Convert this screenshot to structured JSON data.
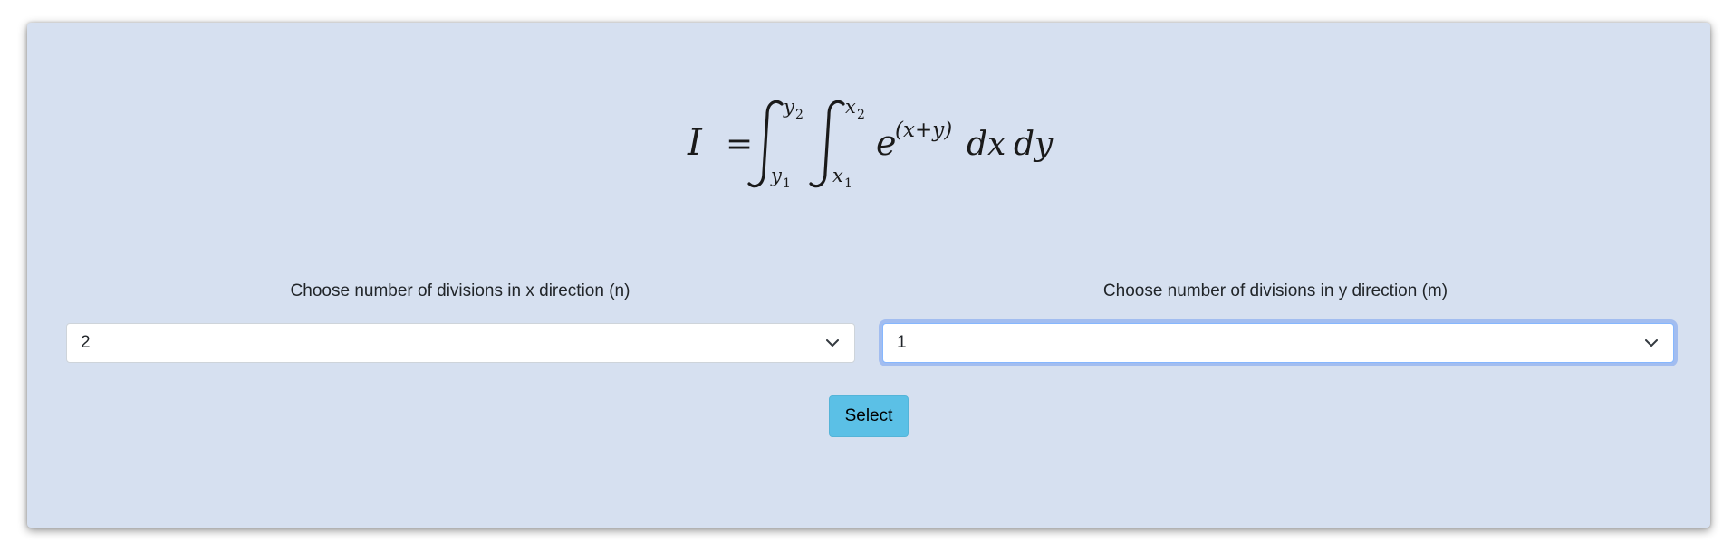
{
  "formula": {
    "lhs": "I",
    "eq": "=",
    "outer_upper": "y",
    "outer_upper_sub": "2",
    "outer_lower": "y",
    "outer_lower_sub": "1",
    "inner_upper": "x",
    "inner_upper_sub": "2",
    "inner_lower": "x",
    "inner_lower_sub": "1",
    "base": "e",
    "exponent": "(x+y)",
    "dx": "dx",
    "dy": "dy"
  },
  "n_select": {
    "label": "Choose number of divisions in x direction (n)",
    "value": "2",
    "icon": "chevron-down-icon"
  },
  "m_select": {
    "label": "Choose number of divisions in y direction (m)",
    "value": "1",
    "icon": "chevron-down-icon"
  },
  "select_button": {
    "label": "Select",
    "color": "#5bc0e6"
  },
  "colors": {
    "panel_background": "#d6e0f0",
    "focus_ring": "#86b7fe"
  }
}
